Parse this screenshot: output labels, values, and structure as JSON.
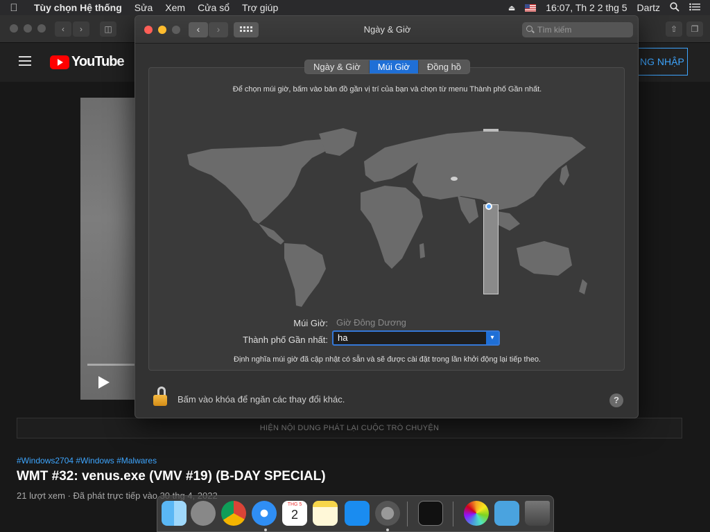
{
  "menubar": {
    "apple": "",
    "app_name": "Tùy chọn Hệ thống",
    "items": [
      "Sửa",
      "Xem",
      "Cửa sổ",
      "Trợ giúp"
    ],
    "clock": "16:07, Th 2 2 thg 5",
    "user": "Dartz"
  },
  "youtube": {
    "logo_text": "YouTube",
    "signin": "NG NHẬP",
    "chat_replay": "HIỆN NỘI DUNG PHÁT LẠI CUỘC TRÒ CHUYỆN",
    "hashtags": "#Windows2704 #Windows #Malwares",
    "video_title": "WMT #32: venus.exe (VMV #19) (B-DAY SPECIAL)",
    "video_meta": "21 lượt xem · Đã phát trực tiếp vào 30 thg 4, 2022"
  },
  "prefs": {
    "title": "Ngày & Giờ",
    "search_placeholder": "Tìm kiếm",
    "tabs": [
      {
        "label": "Ngày & Giờ",
        "active": false
      },
      {
        "label": "Múi Giờ",
        "active": true
      },
      {
        "label": "Đồng hồ",
        "active": false
      }
    ],
    "instruction": "Để chọn múi giờ, bấm vào bản đồ gần vị trí của bạn và chọn từ menu Thành phố Gần nhất.",
    "timezone_label": "Múi Giờ:",
    "timezone_value": "Giờ Đông Dương",
    "city_label": "Thành phố Gần nhất:",
    "city_value": "ha",
    "note": "Định nghĩa múi giờ đã cập nhật có sẵn và sẽ được cài đặt trong lần khởi động lại tiếp theo.",
    "lock_message": "Bấm vào khóa để ngăn các thay đổi khác.",
    "help": "?"
  },
  "dock": {
    "apps": [
      "finder",
      "launchpad",
      "chrome",
      "safari",
      "calendar",
      "notes",
      "app-store",
      "system-preferences",
      "terminal",
      "photos",
      "downloads-folder",
      "trash"
    ],
    "calendar_month": "THG 5",
    "calendar_day": "2"
  }
}
